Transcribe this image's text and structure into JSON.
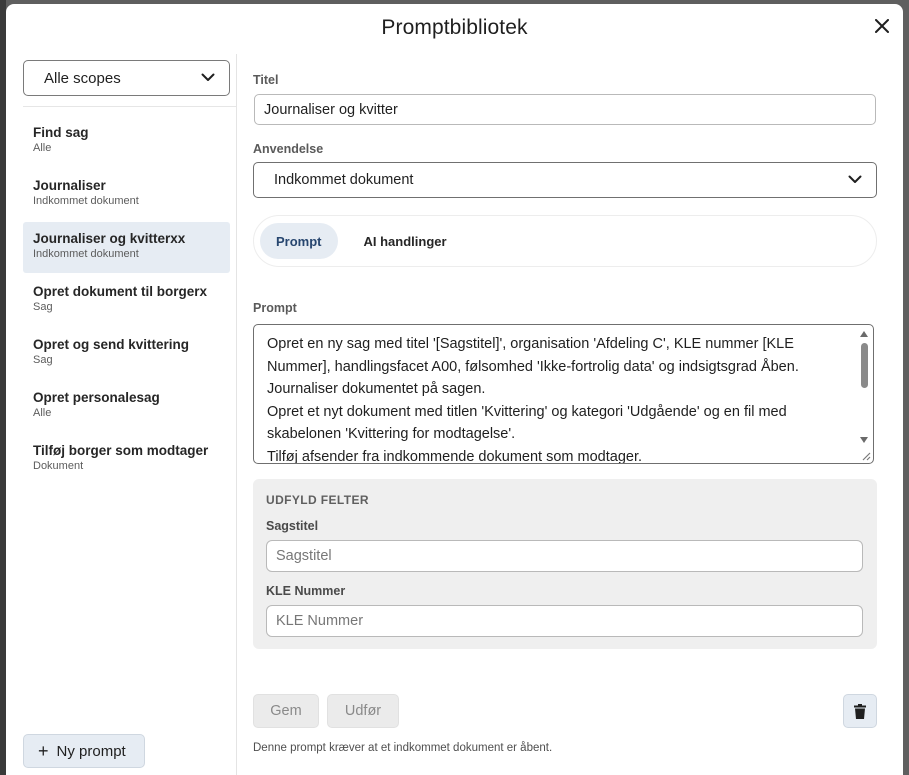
{
  "dialog": {
    "title": "Promptbibliotek"
  },
  "sidebar": {
    "scope_select": "Alle scopes",
    "items": [
      {
        "title": "Find sag",
        "scope": "Alle"
      },
      {
        "title": "Journaliser",
        "scope": "Indkommet dokument"
      },
      {
        "title": "Journaliser og kvitterxx",
        "scope": "Indkommet dokument",
        "active": true
      },
      {
        "title": "Opret dokument til borgerx",
        "scope": "Sag"
      },
      {
        "title": "Opret og send kvittering",
        "scope": "Sag"
      },
      {
        "title": "Opret personalesag",
        "scope": "Alle"
      },
      {
        "title": "Tilføj borger som modtager",
        "scope": "Dokument"
      }
    ],
    "new_prompt_label": "Ny prompt"
  },
  "editor": {
    "title_label": "Titel",
    "title_value": "Journaliser og kvitter",
    "usage_label": "Anvendelse",
    "usage_value": "Indkommet dokument",
    "tabs": [
      {
        "label": "Prompt",
        "active": true
      },
      {
        "label": "AI handlinger",
        "active": false
      }
    ],
    "prompt_label": "Prompt",
    "prompt_text": "Opret en ny sag med titel '[Sagstitel]', organisation 'Afdeling C', KLE nummer [KLE Nummer], handlingsfacet A00, følsomhed 'Ikke-fortrolig data' og indsigtsgrad Åben.\nJournaliser dokumentet på sagen.\nOpret et nyt dokument med titlen 'Kvittering' og kategori 'Udgående' og en fil med skabelonen 'Kvittering for modtagelse'.\nTilføj afsender fra indkommende dokument som modtager.",
    "fill_fields": {
      "heading": "UDFYLD FELTER",
      "fields": [
        {
          "label": "Sagstitel",
          "placeholder": "Sagstitel"
        },
        {
          "label": "KLE Nummer",
          "placeholder": "KLE Nummer"
        }
      ]
    },
    "save_label": "Gem",
    "execute_label": "Udfør",
    "footer_note": "Denne prompt kræver at et indkommet dokument er åbent."
  },
  "colors": {
    "accent_bg": "#e6ecf3",
    "accent_text": "#27466f"
  }
}
